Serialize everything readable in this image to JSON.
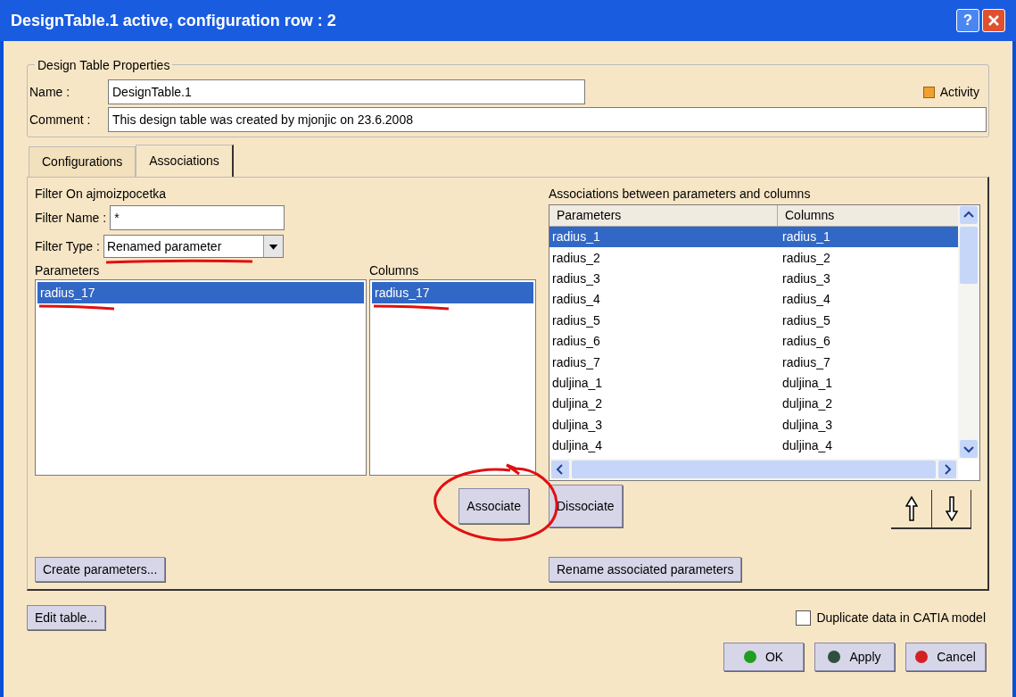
{
  "window": {
    "title": "DesignTable.1 active, configuration row : 2",
    "help": "?"
  },
  "properties": {
    "group_title": "Design Table Properties",
    "name_label": "Name :",
    "name_value": "DesignTable.1",
    "comment_label": "Comment :",
    "comment_value": "This design table was created by mjonjic on 23.6.2008",
    "activity": {
      "label": "Activity",
      "checked": true
    }
  },
  "tabs": [
    {
      "label": "Configurations",
      "selected": false
    },
    {
      "label": "Associations",
      "selected": true
    }
  ],
  "filter": {
    "title": "Filter On ajmoizpocetka",
    "name_label": "Filter Name :",
    "name_value": "*",
    "type_label": "Filter Type :",
    "type_value": "Renamed parameter"
  },
  "parameters": {
    "heading": "Parameters",
    "items": [
      {
        "text": "radius_17",
        "selected": true
      }
    ]
  },
  "columns": {
    "heading": "Columns",
    "items": [
      {
        "text": "radius_17",
        "selected": true
      }
    ]
  },
  "associate_button": "Associate",
  "create_button": "Create parameters...",
  "associations": {
    "title": "Associations between parameters and columns",
    "headers": [
      "Parameters",
      "Columns"
    ],
    "rows": [
      {
        "parameter": "radius_1",
        "column": "radius_1",
        "selected": true
      },
      {
        "parameter": "radius_2",
        "column": "radius_2",
        "selected": false
      },
      {
        "parameter": "radius_3",
        "column": "radius_3",
        "selected": false
      },
      {
        "parameter": "radius_4",
        "column": "radius_4",
        "selected": false
      },
      {
        "parameter": "radius_5",
        "column": "radius_5",
        "selected": false
      },
      {
        "parameter": "radius_6",
        "column": "radius_6",
        "selected": false
      },
      {
        "parameter": "radius_7",
        "column": "radius_7",
        "selected": false
      },
      {
        "parameter": "duljina_1",
        "column": "duljina_1",
        "selected": false
      },
      {
        "parameter": "duljina_2",
        "column": "duljina_2",
        "selected": false
      },
      {
        "parameter": "duljina_3",
        "column": "duljina_3",
        "selected": false
      },
      {
        "parameter": "duljina_4",
        "column": "duljina_4",
        "selected": false
      }
    ]
  },
  "dissociate_button": "Dissociate",
  "rename_button": "Rename associated parameters",
  "edit_table_button": "Edit table...",
  "duplicate": {
    "label": "Duplicate data in CATIA model",
    "checked": false
  },
  "dialog_buttons": [
    {
      "label": "OK",
      "color": "#1f9e1f"
    },
    {
      "label": "Apply",
      "color": "#2f4f3f"
    },
    {
      "label": "Cancel",
      "color": "#d42020"
    }
  ]
}
